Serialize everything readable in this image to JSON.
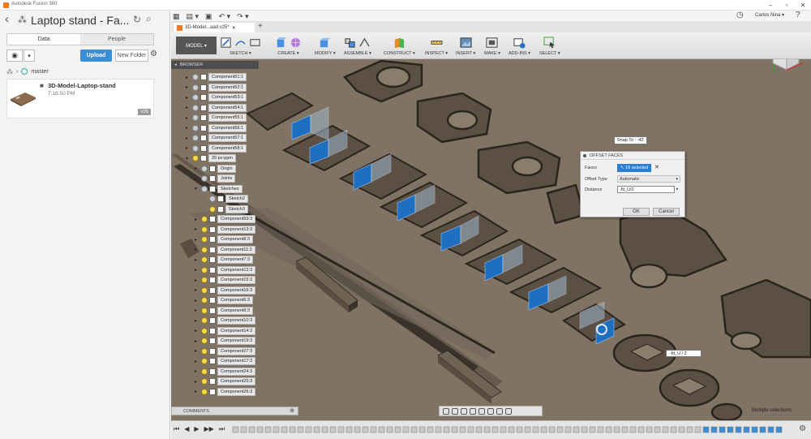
{
  "window": {
    "title": "Autodesk Fusion 360"
  },
  "data_panel": {
    "project_title": "Laptop stand - Fa...",
    "tabs": [
      {
        "label": "Data",
        "active": true
      },
      {
        "label": "People",
        "active": false
      }
    ],
    "upload_label": "Upload",
    "new_folder_label": "New Folder",
    "branch": "master",
    "item": {
      "name": "3D-Model-Laptop-stand",
      "time": "7:18:50 PM",
      "version": "V25"
    }
  },
  "topbar": {
    "user": "Carlos Nina ▾"
  },
  "doc_tab": {
    "label": "3D-Model...aad v25*"
  },
  "toolbar": {
    "workspace": "MODEL ▾",
    "groups": [
      {
        "label": "SKETCH ▾"
      },
      {
        "label": "CREATE ▾"
      },
      {
        "label": "MODIFY ▾"
      },
      {
        "label": "ASSEMBLE ▾"
      },
      {
        "label": "CONSTRUCT ▾"
      },
      {
        "label": "INSPECT ▾"
      },
      {
        "label": "INSERT ▾"
      },
      {
        "label": "MAKE ▾"
      },
      {
        "label": "ADD-INS ▾"
      },
      {
        "label": "SELECT ▾"
      }
    ]
  },
  "browser": {
    "title": "BROWSER",
    "components_top": [
      "Component51:1",
      "Component52:1",
      "Component53:1",
      "Component54:1",
      "Component55:1",
      "Component56:1",
      "Component57:1",
      "Component58:1"
    ],
    "active_component": "20 pv-ppm",
    "sub_items": [
      "Origin",
      "Joints",
      "Sketches"
    ],
    "sketches": [
      "Sketch2",
      "Sketch3"
    ],
    "components_bottom": [
      "Component59:3",
      "Component13:3",
      "Component8:3",
      "Component11:3",
      "Component7:3",
      "Component12:3",
      "Component15:3",
      "Component16:3",
      "Component6:3",
      "Component9:3",
      "Component10:3",
      "Component14:3",
      "Component19:3",
      "Component27:3",
      "Component17:3",
      "Component24:3",
      "Component25:3",
      "Component26:3"
    ]
  },
  "comments": {
    "label": "COMMENTS"
  },
  "dialog": {
    "title": "OFFSET FACES",
    "faces_label": "Faces",
    "faces_value": "16 selected",
    "offset_type_label": "Offset Type",
    "offset_type_value": "Automatic",
    "distance_label": "Distance",
    "distance_value": "-fit_U/2",
    "ok": "OK",
    "cancel": "Cancel"
  },
  "snap_to": "Snap To : -42",
  "dim_input": "-fit_U / 2",
  "status": "Multiple selections",
  "colors": {
    "viewport": "#817363",
    "selection": "#1f6fc0",
    "accent": "#3a8ed8"
  }
}
